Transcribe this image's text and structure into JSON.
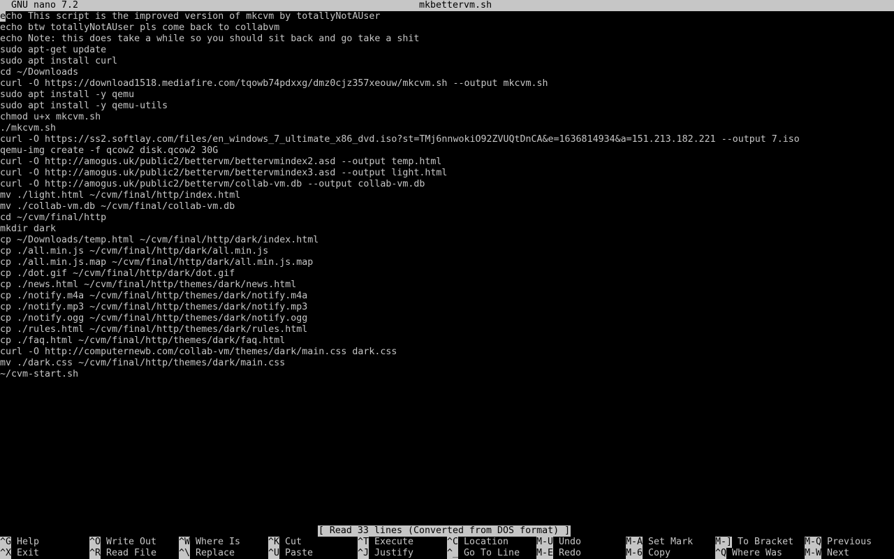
{
  "titlebar": {
    "app": "GNU nano 7.2",
    "file": "mkbettervm.sh"
  },
  "editor": {
    "lines": [
      "echo This script is the improved version of mkcvm by totallyNotAUser",
      "echo btw totallyNotAUser pls come back to collabvm",
      "echo Note: this does take a while so you should sit back and go take a shit",
      "sudo apt-get update",
      "sudo apt install curl",
      "cd ~/Downloads",
      "curl -O https://download1518.mediafire.com/tqowb74pdxxg/dmz0cjz357xeouw/mkcvm.sh --output mkcvm.sh",
      "sudo apt install -y qemu",
      "sudo apt install -y qemu-utils",
      "chmod u+x mkcvm.sh",
      "./mkcvm.sh",
      "curl -O https://ss2.softlay.com/files/en_windows_7_ultimate_x86_dvd.iso?st=TMj6nnwokiO92ZVUQtDnCA&e=1636814934&a=151.213.182.221 --output 7.iso",
      "qemu-img create -f qcow2 disk.qcow2 30G",
      "curl -O http://amogus.uk/public2/bettervm/bettervmindex2.asd --output temp.html",
      "curl -O http://amogus.uk/public2/bettervm/bettervmindex3.asd --output light.html",
      "curl -O http://amogus.uk/public2/bettervm/collab-vm.db --output collab-vm.db",
      "mv ./light.html ~/cvm/final/http/index.html",
      "mv ./collab-vm.db ~/cvm/final/collab-vm.db",
      "cd ~/cvm/final/http",
      "mkdir dark",
      "cp ~/Downloads/temp.html ~/cvm/final/http/dark/index.html",
      "cp ./all.min.js ~/cvm/final/http/dark/all.min.js",
      "cp ./all.min.js.map ~/cvm/final/http/dark/all.min.js.map",
      "cp ./dot.gif ~/cvm/final/http/dark/dot.gif",
      "cp ./news.html ~/cvm/final/http/themes/dark/news.html",
      "cp ./notify.m4a ~/cvm/final/http/themes/dark/notify.m4a",
      "cp ./notify.mp3 ~/cvm/final/http/themes/dark/notify.mp3",
      "cp ./notify.ogg ~/cvm/final/http/themes/dark/notify.ogg",
      "cp ./rules.html ~/cvm/final/http/themes/dark/rules.html",
      "cp ./faq.html ~/cvm/final/http/themes/dark/faq.html",
      "curl -O http://computernewb.com/collab-vm/themes/dark/main.css dark.css",
      "mv ./dark.css ~/cvm/final/http/themes/dark/main.css",
      "~/cvm-start.sh"
    ]
  },
  "status": {
    "message": "[ Read 33 lines (Converted from DOS format) ]"
  },
  "shortcuts": [
    {
      "key": "^G",
      "label": "Help"
    },
    {
      "key": "^X",
      "label": "Exit"
    },
    {
      "key": "^O",
      "label": "Write Out"
    },
    {
      "key": "^R",
      "label": "Read File"
    },
    {
      "key": "^W",
      "label": "Where Is"
    },
    {
      "key": "^\\",
      "label": "Replace"
    },
    {
      "key": "^K",
      "label": "Cut"
    },
    {
      "key": "^U",
      "label": "Paste"
    },
    {
      "key": "^T",
      "label": "Execute"
    },
    {
      "key": "^J",
      "label": "Justify"
    },
    {
      "key": "^C",
      "label": "Location"
    },
    {
      "key": "^_",
      "label": "Go To Line"
    },
    {
      "key": "M-U",
      "label": "Undo"
    },
    {
      "key": "M-E",
      "label": "Redo"
    },
    {
      "key": "M-A",
      "label": "Set Mark"
    },
    {
      "key": "M-6",
      "label": "Copy"
    },
    {
      "key": "M-]",
      "label": "To Bracket"
    },
    {
      "key": "^Q",
      "label": "Where Was"
    },
    {
      "key": "M-Q",
      "label": "Previous"
    },
    {
      "key": "M-W",
      "label": "Next"
    }
  ],
  "colors": {
    "background": "#000000",
    "foreground": "#c6c6c6",
    "inverse_bg": "#c6c6c6",
    "inverse_fg": "#000000"
  }
}
